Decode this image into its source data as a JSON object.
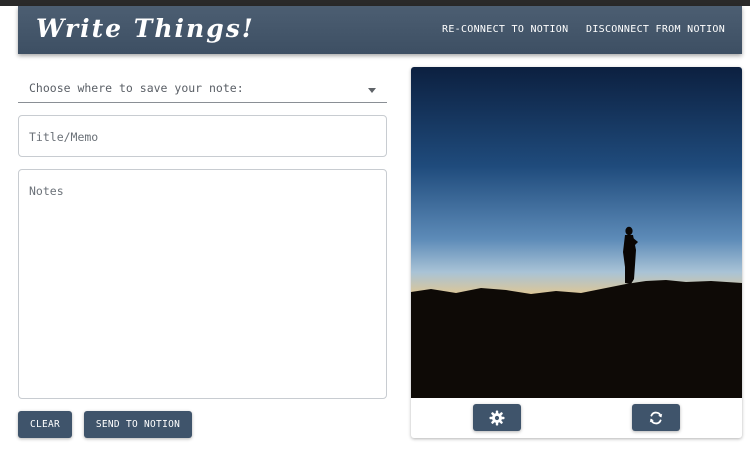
{
  "app": {
    "title": "Write Things!",
    "nav": {
      "reconnect_label": "RE-CONNECT TO NOTION",
      "disconnect_label": "DISCONNECT FROM NOTION"
    }
  },
  "form": {
    "save_location": {
      "placeholder": "Choose where to save your note:",
      "icon": "chevron-down-icon"
    },
    "title_field": {
      "placeholder": "Title/Memo",
      "value": ""
    },
    "notes_field": {
      "placeholder": "Notes",
      "value": ""
    },
    "clear_label": "CLEAR",
    "send_label": "SEND TO NOTION"
  },
  "image_card": {
    "photo": "silhouette-at-sunset",
    "settings_icon": "gear-icon",
    "refresh_icon": "refresh-icon"
  },
  "colors": {
    "appbar": "#3d4f63",
    "button": "#3f546b",
    "text_on_dark": "#ffffff"
  }
}
